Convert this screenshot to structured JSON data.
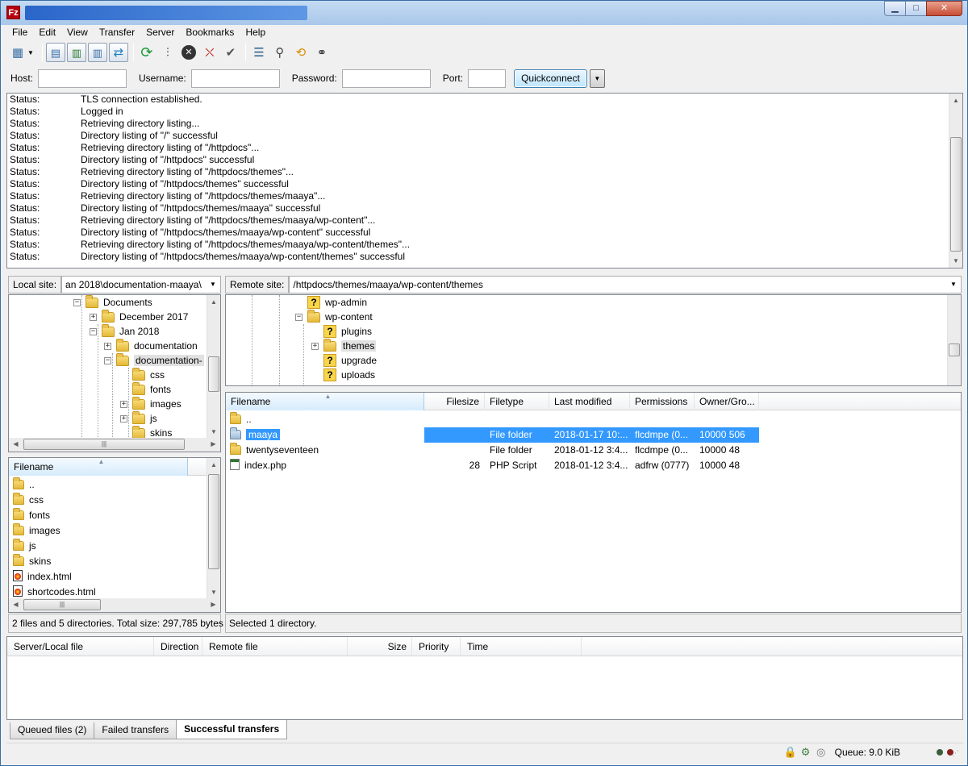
{
  "app": {
    "icon_text": "Fz"
  },
  "window_buttons": {
    "minimize": "▁",
    "maximize": "□",
    "close": "✕"
  },
  "menu": [
    "File",
    "Edit",
    "View",
    "Transfer",
    "Server",
    "Bookmarks",
    "Help"
  ],
  "quickconnect": {
    "host_label": "Host:",
    "username_label": "Username:",
    "password_label": "Password:",
    "port_label": "Port:",
    "host_value": "",
    "username_value": "",
    "password_value": "",
    "port_value": "",
    "button_label": "Quickconnect"
  },
  "log": [
    {
      "type": "Status:",
      "msg": "TLS connection established."
    },
    {
      "type": "Status:",
      "msg": "Logged in"
    },
    {
      "type": "Status:",
      "msg": "Retrieving directory listing..."
    },
    {
      "type": "Status:",
      "msg": "Directory listing of \"/\" successful"
    },
    {
      "type": "Status:",
      "msg": "Retrieving directory listing of \"/httpdocs\"..."
    },
    {
      "type": "Status:",
      "msg": "Directory listing of \"/httpdocs\" successful"
    },
    {
      "type": "Status:",
      "msg": "Retrieving directory listing of \"/httpdocs/themes\"..."
    },
    {
      "type": "Status:",
      "msg": "Directory listing of \"/httpdocs/themes\" successful"
    },
    {
      "type": "Status:",
      "msg": "Retrieving directory listing of \"/httpdocs/themes/maaya\"..."
    },
    {
      "type": "Status:",
      "msg": "Directory listing of \"/httpdocs/themes/maaya\" successful"
    },
    {
      "type": "Status:",
      "msg": "Retrieving directory listing of \"/httpdocs/themes/maaya/wp-content\"..."
    },
    {
      "type": "Status:",
      "msg": "Directory listing of \"/httpdocs/themes/maaya/wp-content\" successful"
    },
    {
      "type": "Status:",
      "msg": "Retrieving directory listing of \"/httpdocs/themes/maaya/wp-content/themes\"..."
    },
    {
      "type": "Status:",
      "msg": "Directory listing of \"/httpdocs/themes/maaya/wp-content/themes\" successful"
    }
  ],
  "local": {
    "site_label": "Local site:",
    "site_path": "an 2018\\documentation-maaya\\",
    "tree": [
      {
        "label": "Documents",
        "exp": "-"
      },
      {
        "label": "December 2017",
        "exp": "+"
      },
      {
        "label": "Jan 2018",
        "exp": "-"
      },
      {
        "label": "documentation",
        "exp": "+"
      },
      {
        "label": "documentation-",
        "exp": "-"
      },
      {
        "label": "css",
        "exp": ""
      },
      {
        "label": "fonts",
        "exp": ""
      },
      {
        "label": "images",
        "exp": "+"
      },
      {
        "label": "js",
        "exp": "+"
      },
      {
        "label": "skins",
        "exp": ""
      }
    ],
    "list_header": "Filename",
    "files": [
      {
        "name": "..",
        "kind": "folder"
      },
      {
        "name": "css",
        "kind": "folder"
      },
      {
        "name": "fonts",
        "kind": "folder"
      },
      {
        "name": "images",
        "kind": "folder"
      },
      {
        "name": "js",
        "kind": "folder"
      },
      {
        "name": "skins",
        "kind": "folder"
      },
      {
        "name": "index.html",
        "kind": "html"
      },
      {
        "name": "shortcodes.html",
        "kind": "html"
      }
    ],
    "status": "2 files and 5 directories. Total size: 297,785 bytes"
  },
  "remote": {
    "site_label": "Remote site:",
    "site_path": "/httpdocs/themes/maaya/wp-content/themes",
    "tree": [
      {
        "label": "wp-admin",
        "icon": "q",
        "exp": ""
      },
      {
        "label": "wp-content",
        "icon": "folder",
        "exp": "-"
      },
      {
        "label": "plugins",
        "icon": "q",
        "exp": ""
      },
      {
        "label": "themes",
        "icon": "folder",
        "exp": "+"
      },
      {
        "label": "upgrade",
        "icon": "q",
        "exp": ""
      },
      {
        "label": "uploads",
        "icon": "q",
        "exp": ""
      }
    ],
    "columns": [
      "Filename",
      "Filesize",
      "Filetype",
      "Last modified",
      "Permissions",
      "Owner/Gro..."
    ],
    "files": [
      {
        "name": "..",
        "size": "",
        "type": "",
        "modified": "",
        "perms": "",
        "owner": "",
        "kind": "folder"
      },
      {
        "name": "maaya",
        "size": "",
        "type": "File folder",
        "modified": "2018-01-17 10:...",
        "perms": "flcdmpe (0...",
        "owner": "10000 506",
        "kind": "folder-blue"
      },
      {
        "name": "twentyseventeen",
        "size": "",
        "type": "File folder",
        "modified": "2018-01-12 3:4...",
        "perms": "flcdmpe (0...",
        "owner": "10000 48",
        "kind": "folder"
      },
      {
        "name": "index.php",
        "size": "28",
        "type": "PHP Script",
        "modified": "2018-01-12 3:4...",
        "perms": "adfrw (0777)",
        "owner": "10000 48",
        "kind": "php"
      }
    ],
    "status": "Selected 1 directory."
  },
  "queue": {
    "columns": [
      "Server/Local file",
      "Direction",
      "Remote file",
      "Size",
      "Priority",
      "Time"
    ],
    "tabs": [
      "Queued files (2)",
      "Failed transfers",
      "Successful transfers"
    ],
    "active_tab": 2
  },
  "statusbar": {
    "queue": "Queue: 9.0 KiB"
  },
  "colors": {
    "selection": "#3399ff",
    "led_left": "#3a5f3a",
    "led_right": "#8a1f1f"
  }
}
